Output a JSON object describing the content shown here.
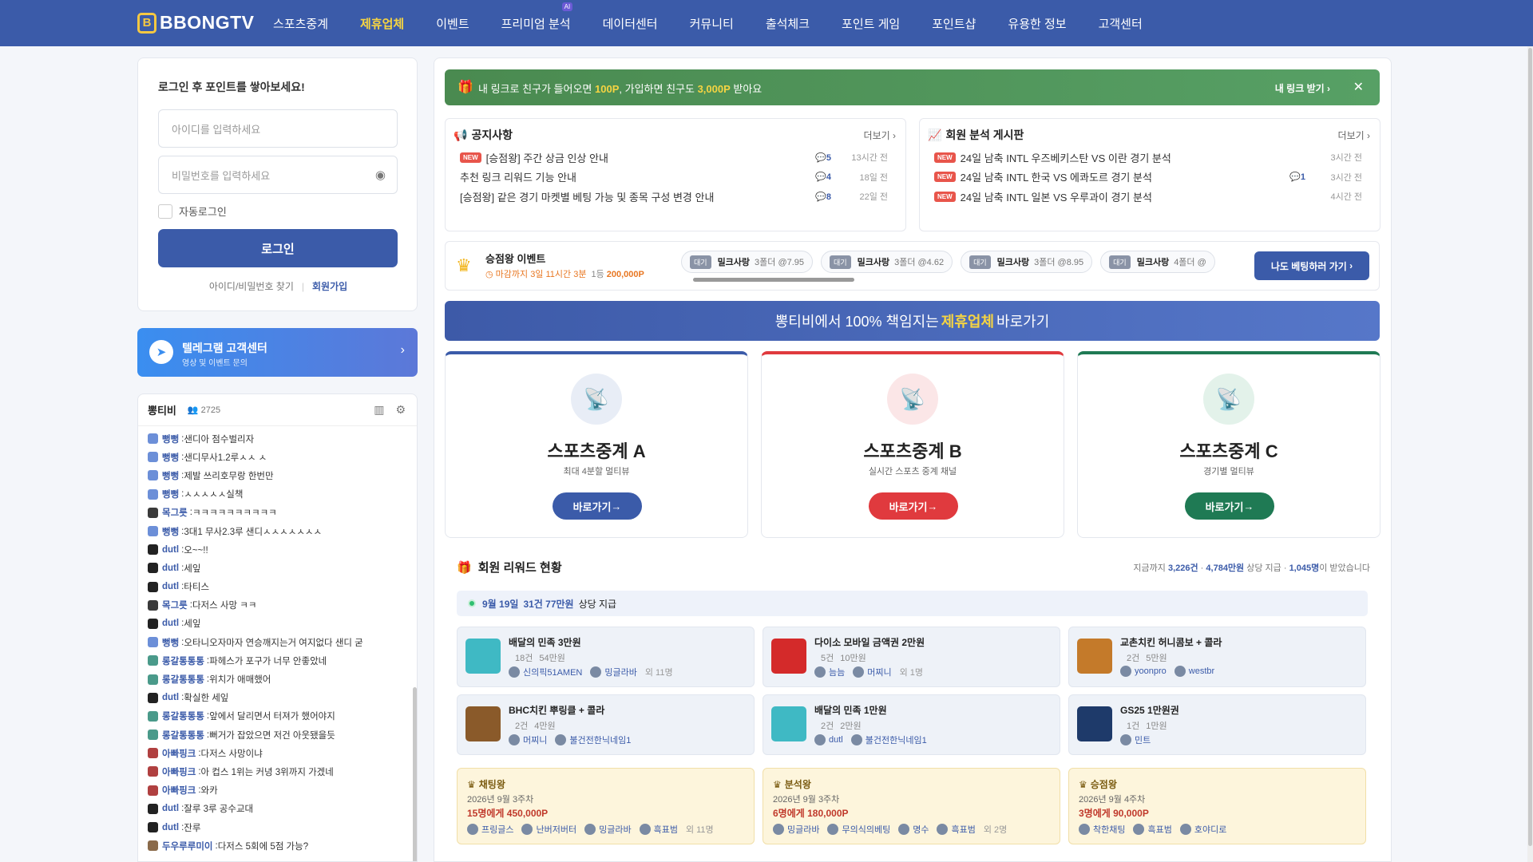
{
  "nav": {
    "logo_mark": "B",
    "logo_text": "BBONGTV",
    "items": [
      "스포츠중계",
      "제휴업체",
      "이벤트",
      "프리미엄 분석",
      "데이터센터",
      "커뮤니티",
      "출석체크",
      "포인트 게임",
      "포인트샵",
      "유용한 정보",
      "고객센터"
    ],
    "ai_badge": "AI",
    "active": "제휴업체"
  },
  "login": {
    "title": "로그인 후 포인트를 쌓아보세요!",
    "id_placeholder": "아이디를 입력하세요",
    "pw_placeholder": "비밀번호를 입력하세요",
    "auto_login": "자동로그인",
    "button": "로그인",
    "find": "아이디/비밀번호 찾기",
    "join": "회원가입"
  },
  "telegram": {
    "title": "텔레그램 고객센터",
    "sub": "영상 및 이벤트 문의"
  },
  "chat": {
    "title": "뽕티비",
    "count": "2725",
    "lines": [
      {
        "nick": "뻥뻥",
        "msg": "샌디아 점수벌리자",
        "c": "#6c8fd8"
      },
      {
        "nick": "뻥뻥",
        "msg": "샌디무사1.2루ㅅㅅ ㅅ",
        "c": "#6c8fd8"
      },
      {
        "nick": "뻥뻥",
        "msg": "제발 쓰리호무랑 한번만",
        "c": "#6c8fd8"
      },
      {
        "nick": "뻥뻥",
        "msg": "ㅅㅅㅅㅅㅅ실책",
        "c": "#6c8fd8"
      },
      {
        "nick": "목그릇",
        "msg": "ㅋㅋㅋㅋㅋㅋㅋㅋㅋㅋ",
        "c": "#3a3a3a"
      },
      {
        "nick": "뻥뻥",
        "msg": "3대1 무사2.3루 샌디ㅅㅅㅅㅅㅅㅅㅅ",
        "c": "#6c8fd8"
      },
      {
        "nick": "dutl",
        "msg": "오~~!!",
        "c": "#222"
      },
      {
        "nick": "dutl",
        "msg": "세잎",
        "c": "#222"
      },
      {
        "nick": "dutl",
        "msg": "타티스",
        "c": "#222"
      },
      {
        "nick": "목그릇",
        "msg": "다저스 사망 ㅋㅋ",
        "c": "#3a3a3a"
      },
      {
        "nick": "dutl",
        "msg": "세잎",
        "c": "#222"
      },
      {
        "nick": "뻥뻥",
        "msg": "오타니오자마자 연승깨지는거 여지없다 샌디 굳",
        "c": "#6c8fd8"
      },
      {
        "nick": "롱갈통통통",
        "msg": "파헤스가 포구가 너무 안좋았네",
        "c": "#4a9a8a"
      },
      {
        "nick": "롱갈통통통",
        "msg": "위치가 애매했어",
        "c": "#4a9a8a"
      },
      {
        "nick": "dutl",
        "msg": "확실한 세잎",
        "c": "#222"
      },
      {
        "nick": "롱갈통통통",
        "msg": "앞에서 달리면서 터져가 했어야지",
        "c": "#4a9a8a"
      },
      {
        "nick": "롱갈통통통",
        "msg": "뻐거가 잡았으면 저건 아웃됐을듯",
        "c": "#4a9a8a"
      },
      {
        "nick": "아빠핑크",
        "msg": "다저스 사망이냐",
        "c": "#b04040"
      },
      {
        "nick": "아빠핑크",
        "msg": "아 컵스 1위는 커녕 3위까지 가겠네",
        "c": "#b04040"
      },
      {
        "nick": "아빠핑크",
        "msg": "와카",
        "c": "#b04040"
      },
      {
        "nick": "dutl",
        "msg": "잘루 3루 공수교대",
        "c": "#222"
      },
      {
        "nick": "dutl",
        "msg": "잔루",
        "c": "#222"
      },
      {
        "nick": "두우루루미이",
        "msg": "다저스 5회에 5점 가능?",
        "c": "#8a6a4a"
      }
    ]
  },
  "promo": {
    "pre": "내 링크로 친구가 들어오면 ",
    "amt1": "100P",
    "mid": ", 가입하면 친구도 ",
    "amt2": "3,000P",
    "post": " 받아요",
    "link": "내 링크 받기",
    "close": "✕"
  },
  "notice": {
    "title": "공지사항",
    "more": "더보기",
    "rows": [
      {
        "new": true,
        "text": "[승점왕] 주간 상금 인상 안내",
        "cmt": "5",
        "time": "13시간 전"
      },
      {
        "new": false,
        "text": "추천 링크 리워드 기능 안내",
        "cmt": "4",
        "time": "18일 전"
      },
      {
        "new": false,
        "text": "[승점왕] 같은 경기 마켓별 베팅 가능 및 종목 구성 변경 안내",
        "cmt": "8",
        "time": "22일 전"
      }
    ]
  },
  "analysis": {
    "title": "회원 분석 게시판",
    "more": "더보기",
    "rows": [
      {
        "new": true,
        "text": "24일 남축 INTL 우즈베키스탄 VS 이란 경기 분석",
        "cmt": "",
        "time": "3시간 전"
      },
      {
        "new": true,
        "text": "24일 남축 INTL 한국 VS 에콰도르 경기 분석",
        "cmt": "1",
        "time": "3시간 전"
      },
      {
        "new": true,
        "text": "24일 남축 INTL 일본 VS 우루과이 경기 분석",
        "cmt": "",
        "time": "4시간 전"
      }
    ],
    "new_label": "NEW"
  },
  "event": {
    "title": "승점왕 이벤트",
    "deadline": "마감까지 3일 11시간 3분",
    "rank": "1등",
    "prize": "200,000P",
    "chips": [
      {
        "status": "대기",
        "name": "밀크사랑",
        "odds": "3폴더 @7.95"
      },
      {
        "status": "대기",
        "name": "밀크사랑",
        "odds": "3폴더 @4.62"
      },
      {
        "status": "대기",
        "name": "밀크사랑",
        "odds": "3폴더 @8.95"
      },
      {
        "status": "대기",
        "name": "밀크사랑",
        "odds": "4폴더 @"
      }
    ],
    "button": "나도 베팅하러 가기"
  },
  "partner": {
    "pre": "뽕티비에서 100% 책임지는 ",
    "hl": "제휴업체",
    "post": " 바로가기"
  },
  "cards": [
    {
      "title": "스포츠중계 A",
      "sub": "최대 4분할 멀티뷰",
      "btn": "바로가기",
      "color": "#3b5ba9",
      "bg": "#e8edf6"
    },
    {
      "title": "스포츠중계 B",
      "sub": "실시간 스포츠 중계 채널",
      "btn": "바로가기",
      "color": "#e03a3e",
      "bg": "#fbe6e7"
    },
    {
      "title": "스포츠중계 C",
      "sub": "경기별 멀티뷰",
      "btn": "바로가기",
      "color": "#1f7a54",
      "bg": "#e3f2ea"
    }
  ],
  "reward": {
    "title": "회원 리워드 현황",
    "stats_pre": "지금까지 ",
    "count": "3,226건",
    "amount": "4,784만원",
    "people": "1,045명",
    "stats_mid": " 상당 지급 · ",
    "stats_post": "이 받았습니다",
    "date": "9월 19일",
    "date_sum": "31건 77만원",
    "date_post": "상당 지급",
    "items": [
      {
        "name": "배달의 민족 3만원",
        "cnt": "18건",
        "amt": "54만원",
        "u1": "신의픽51AMEN",
        "u2": "밍글라바",
        "etc": "외 11명",
        "thumb": "#3fb9c4"
      },
      {
        "name": "다이소 모바일 금액권 2만원",
        "cnt": "5건",
        "amt": "10만원",
        "u1": "늠늠",
        "u2": "머찌니",
        "etc": "외 1명",
        "thumb": "#d42a2a"
      },
      {
        "name": "교촌치킨 허니콤보 + 콜라",
        "cnt": "2건",
        "amt": "5만원",
        "u1": "yoonpro",
        "u2": "westbr",
        "etc": "",
        "thumb": "#c47a2a"
      },
      {
        "name": "BHC치킨 뿌링클 + 콜라",
        "cnt": "2건",
        "amt": "4만원",
        "u1": "머찌니",
        "u2": "불건전한닉네임1",
        "etc": "",
        "thumb": "#8a5a2a"
      },
      {
        "name": "배달의 민족 1만원",
        "cnt": "2건",
        "amt": "2만원",
        "u1": "dutl",
        "u2": "불건전한닉네임1",
        "etc": "",
        "thumb": "#3fb9c4"
      },
      {
        "name": "GS25 1만원권",
        "cnt": "1건",
        "amt": "1만원",
        "u1": "민트",
        "u2": "",
        "etc": "",
        "thumb": "#1e3a6a"
      }
    ],
    "kings": [
      {
        "title": "채팅왕",
        "week": "2026년 9월 3주차",
        "prize": "15명에게 450,000P",
        "users": [
          "프링글스",
          "난버저버터",
          "밍글라바",
          "흑표범"
        ],
        "etc": "외 11명"
      },
      {
        "title": "분석왕",
        "week": "2026년 9월 3주차",
        "prize": "6명에게 180,000P",
        "users": [
          "밍글라바",
          "무의식의베팅",
          "명수",
          "흑표범"
        ],
        "etc": "외 2명"
      },
      {
        "title": "승점왕",
        "week": "2026년 9월 4주차",
        "prize": "3명에게 90,000P",
        "users": [
          "착한채팅",
          "흑표범",
          "호야디로"
        ],
        "etc": ""
      }
    ]
  }
}
